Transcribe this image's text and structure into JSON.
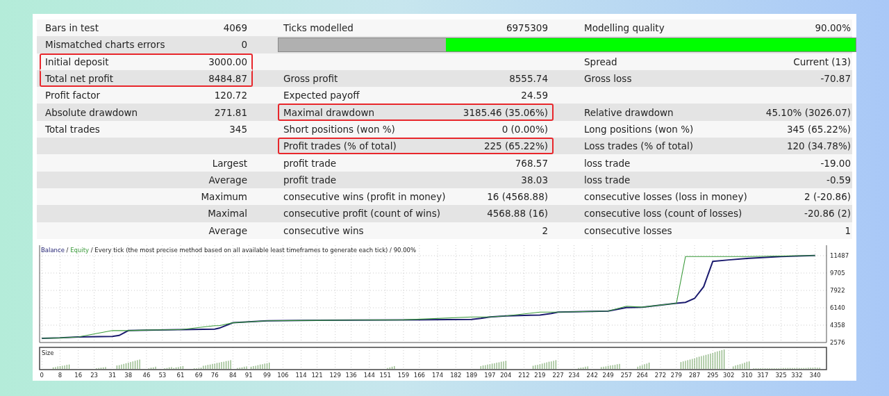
{
  "report": {
    "rows": [
      {
        "cells": [
          {
            "label": "Bars in test",
            "value": "4069"
          },
          {
            "label": "Ticks modelled",
            "value": "6975309"
          },
          {
            "label": "Modelling quality",
            "value": "90.00%"
          }
        ]
      },
      {
        "cells": [
          {
            "label": "Mismatched charts errors",
            "value": "0"
          }
        ],
        "quality_bar": {
          "level": 0.71
        }
      },
      {
        "cells": [
          {
            "label": "Initial deposit",
            "value": "3000.00",
            "highlighted": true
          },
          {},
          {
            "label": "Spread",
            "value": "Current (13)"
          }
        ]
      },
      {
        "cells": [
          {
            "label": "Total net profit",
            "value": "8484.87",
            "highlighted": true
          },
          {
            "label": "Gross profit",
            "value": "8555.74"
          },
          {
            "label": "Gross loss",
            "value": "-70.87"
          }
        ]
      },
      {
        "cells": [
          {
            "label": "Profit factor",
            "value": "120.72"
          },
          {
            "label": "Expected payoff",
            "value": "24.59"
          },
          {}
        ]
      },
      {
        "cells": [
          {
            "label": "Absolute drawdown",
            "value": "271.81"
          },
          {
            "label": "Maximal drawdown",
            "value": "3185.46 (35.06%)",
            "highlighted": true
          },
          {
            "label": "Relative drawdown",
            "value": "45.10% (3026.07)"
          }
        ]
      },
      {
        "cells": [
          {
            "label": "Total trades",
            "value": "345"
          },
          {
            "label": "Short positions (won %)",
            "value": "0 (0.00%)"
          },
          {
            "label": "Long positions (won %)",
            "value": "345 (65.22%)"
          }
        ]
      },
      {
        "cells": [
          {},
          {
            "label": "Profit trades (% of total)",
            "value": "225 (65.22%)",
            "highlighted": true
          },
          {
            "label": "Loss trades (% of total)",
            "value": "120 (34.78%)"
          }
        ]
      },
      {
        "cells": [
          {
            "value": "Largest"
          },
          {
            "label": "profit trade",
            "value": "768.57"
          },
          {
            "label": "loss trade",
            "value": "-19.00"
          }
        ]
      },
      {
        "cells": [
          {
            "value": "Average"
          },
          {
            "label": "profit trade",
            "value": "38.03"
          },
          {
            "label": "loss trade",
            "value": "-0.59"
          }
        ]
      },
      {
        "cells": [
          {
            "value": "Maximum"
          },
          {
            "label": "consecutive wins (profit in money)",
            "value": "16 (4568.88)"
          },
          {
            "label": "consecutive losses (loss in money)",
            "value": "2 (-20.86)"
          }
        ]
      },
      {
        "cells": [
          {
            "value": "Maximal"
          },
          {
            "label": "consecutive profit (count of wins)",
            "value": "4568.88 (16)"
          },
          {
            "label": "consecutive loss (count of losses)",
            "value": "-20.86 (2)"
          }
        ]
      },
      {
        "cells": [
          {
            "value": "Average"
          },
          {
            "label": "consecutive wins",
            "value": "2"
          },
          {
            "label": "consecutive losses",
            "value": "1"
          }
        ]
      }
    ]
  },
  "chart": {
    "legend_separator": "/",
    "title_rest": " / Every tick (the most precise method based on all available least timeframes to generate each tick) / 90.00%",
    "volume_label": "Size",
    "chart_data": {
      "type": "line",
      "grid": true,
      "x": [
        0,
        8,
        16,
        31,
        34,
        38,
        46,
        61,
        76,
        78,
        84,
        99,
        121,
        159,
        189,
        193,
        197,
        204,
        219,
        224,
        227,
        249,
        257,
        264,
        279,
        283,
        287,
        291,
        295,
        302,
        310,
        325,
        340
      ],
      "series": [
        {
          "name": "Balance",
          "color": "#1a1a6e",
          "values": [
            3000,
            3050,
            3150,
            3200,
            3300,
            3800,
            3850,
            3900,
            3950,
            4050,
            4600,
            4800,
            4850,
            4900,
            4950,
            5050,
            5200,
            5300,
            5400,
            5550,
            5700,
            5800,
            6150,
            6200,
            6600,
            6700,
            7100,
            8300,
            10900,
            11050,
            11200,
            11400,
            11500
          ]
        },
        {
          "name": "Equity",
          "color": "#3a9a3a",
          "values": [
            3000,
            3050,
            3150,
            3800,
            3800,
            3800,
            3850,
            3900,
            4300,
            4300,
            4600,
            4800,
            4850,
            4900,
            5200,
            5200,
            5200,
            5300,
            5700,
            5700,
            5700,
            5800,
            6300,
            6200,
            6600,
            11400,
            11400,
            11400,
            11400,
            11400,
            11400,
            11450,
            11500
          ]
        }
      ],
      "xlim": [
        -1,
        345
      ],
      "ylim": [
        2576,
        12556
      ],
      "xticks": [
        0,
        8,
        16,
        23,
        31,
        38,
        46,
        53,
        61,
        69,
        76,
        84,
        91,
        99,
        106,
        114,
        121,
        129,
        136,
        144,
        151,
        159,
        166,
        174,
        182,
        189,
        197,
        204,
        212,
        219,
        227,
        234,
        242,
        249,
        257,
        264,
        272,
        279,
        287,
        295,
        302,
        310,
        317,
        325,
        332,
        340
      ],
      "yticks": [
        2576,
        4358,
        6140,
        7922,
        9705,
        11487
      ]
    }
  }
}
